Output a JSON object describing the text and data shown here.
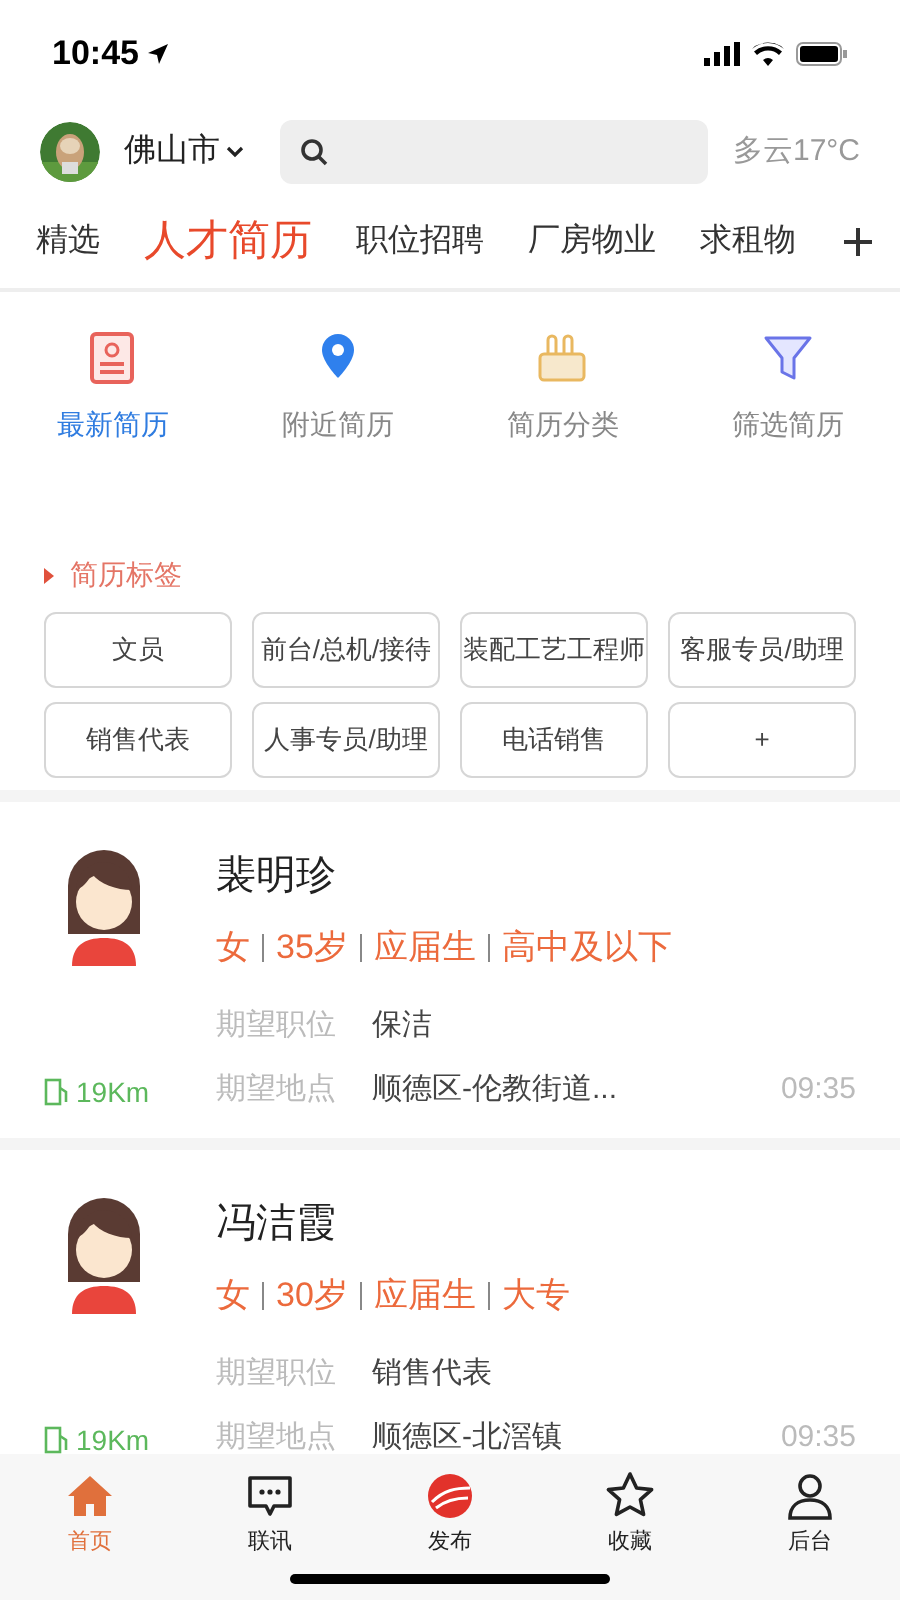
{
  "status_bar": {
    "time": "10:45"
  },
  "header": {
    "city": "佛山市",
    "weather": "多云17°C"
  },
  "channels": [
    {
      "label": "精选",
      "selected": false
    },
    {
      "label": "人才简历",
      "selected": true
    },
    {
      "label": "职位招聘",
      "selected": false
    },
    {
      "label": "厂房物业",
      "selected": false
    },
    {
      "label": "求租物",
      "selected": false
    }
  ],
  "shortcuts": [
    {
      "label": "最新简历",
      "kind": "resume",
      "selected": true
    },
    {
      "label": "附近简历",
      "kind": "pin",
      "selected": false
    },
    {
      "label": "简历分类",
      "kind": "category",
      "selected": false
    },
    {
      "label": "筛选简历",
      "kind": "filter",
      "selected": false
    }
  ],
  "tags_section": {
    "title": "简历标签",
    "tags": [
      "文员",
      "前台/总机/接待",
      "装配工艺工程师",
      "客服专员/助理",
      "销售代表",
      "人事专员/助理",
      "电话销售",
      "+"
    ]
  },
  "resumes": [
    {
      "name": "裴明珍",
      "facts": [
        "女",
        "35岁",
        "应届生",
        "高中及以下"
      ],
      "position_label": "期望职位",
      "position": "保洁",
      "place_label": "期望地点",
      "place": "顺德区-伦教街道...",
      "distance": "19Km",
      "time": "09:35"
    },
    {
      "name": "冯洁霞",
      "facts": [
        "女",
        "30岁",
        "应届生",
        "大专"
      ],
      "position_label": "期望职位",
      "position": "销售代表",
      "place_label": "期望地点",
      "place": "顺德区-北滘镇",
      "distance": "19Km",
      "time": "09:35"
    }
  ],
  "tab_bar": [
    {
      "label": "首页",
      "kind": "home",
      "selected": true
    },
    {
      "label": "联讯",
      "kind": "chat",
      "selected": false
    },
    {
      "label": "发布",
      "kind": "publish",
      "selected": false
    },
    {
      "label": "收藏",
      "kind": "star",
      "selected": false
    },
    {
      "label": "后台",
      "kind": "user",
      "selected": false
    }
  ]
}
